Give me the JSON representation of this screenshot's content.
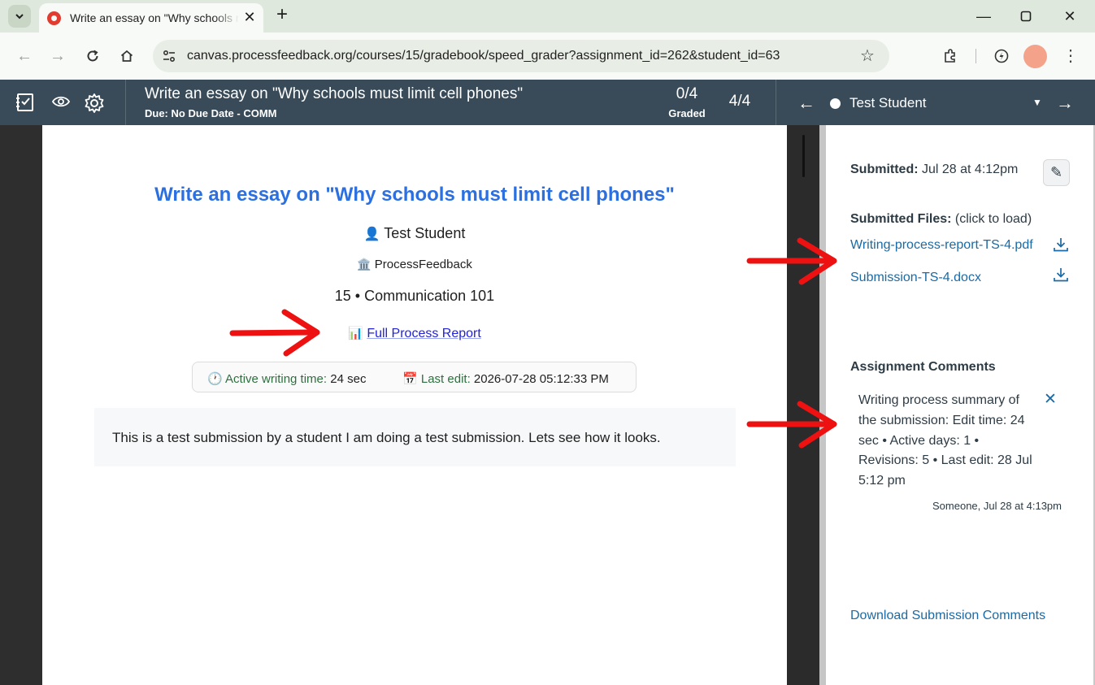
{
  "browser": {
    "tab_title": "Write an essay on \"Why schools must limit cell phones\"",
    "new_tab_label": "+",
    "url": "canvas.processfeedback.org/courses/15/gradebook/speed_grader?assignment_id=262&student_id=63"
  },
  "header": {
    "assignment_title": "Write an essay on \"Why schools must limit cell phones\"",
    "due": "Due: No Due Date - COMM",
    "graded_count": "0/4",
    "graded_label": "Graded",
    "score": "4/4",
    "student_name": "Test Student"
  },
  "document": {
    "title": "Write an essay on \"Why schools must limit cell phones\"",
    "student_icon": "👤",
    "student": "Test Student",
    "org_icon": "🏛️",
    "org": "ProcessFeedback",
    "course": "15 • Communication 101",
    "report_icon": "📊",
    "report_link": "Full Process Report",
    "active_time_icon": "🕐",
    "active_time_label": "Active writing time:",
    "active_time_value": "24 sec",
    "last_edit_icon": "📅",
    "last_edit_label": "Last edit:",
    "last_edit_value": "2026-07-28 05:12:33 PM",
    "submission_text": "This is a test submission by a student I am doing a test submission. Lets see how it looks."
  },
  "panel": {
    "submitted_label": "Submitted:",
    "submitted_value": "Jul 28 at 4:12pm",
    "files_label": "Submitted Files:",
    "files_hint": "(click to load)",
    "files": [
      {
        "name": "Writing-process-report-TS-4.pdf"
      },
      {
        "name": "Submission-TS-4.docx"
      }
    ],
    "comments_heading": "Assignment Comments",
    "comment_text": "Writing process summary of the submission: Edit time: 24 sec • Active days: 1 • Revisions: 5 • Last edit: 28 Jul 5:12 pm",
    "comment_meta": "Someone, Jul 28 at 4:13pm",
    "download_comments": "Download Submission Comments"
  },
  "colors": {
    "header_bg": "#394b58",
    "link": "#1b6aa5",
    "doc_title": "#2b6fe0",
    "annotation_arrow": "#ee1111"
  }
}
